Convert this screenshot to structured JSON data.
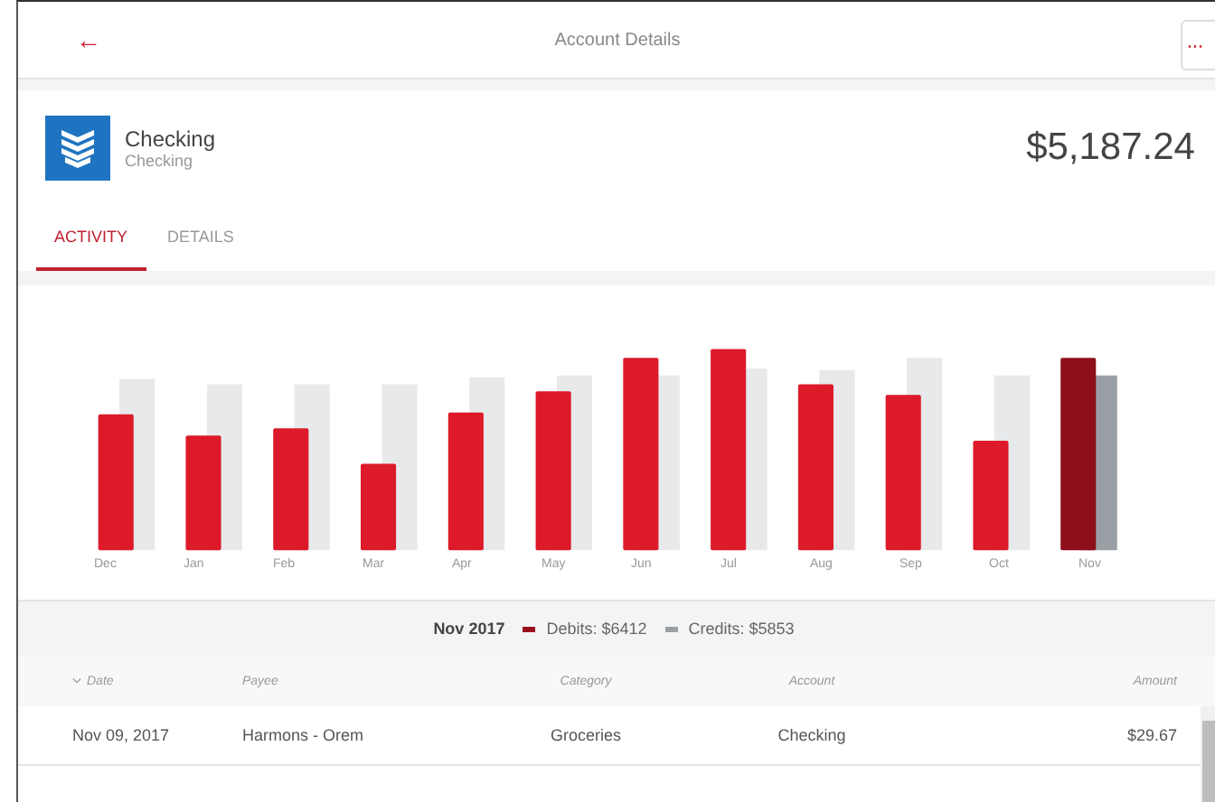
{
  "header": {
    "back": "←",
    "title": "Account Details",
    "more": "···"
  },
  "account": {
    "name": "Checking",
    "type": "Checking",
    "balance": "$5,187.24"
  },
  "tabs": [
    {
      "label": "ACTIVITY",
      "selected": true
    },
    {
      "label": "DETAILS",
      "selected": false
    }
  ],
  "months": [
    {
      "label": "Dec",
      "selected": false
    },
    {
      "label": "Jan",
      "selected": false
    },
    {
      "label": "Feb",
      "selected": false
    },
    {
      "label": "Mar",
      "selected": false
    },
    {
      "label": "Apr",
      "selected": false
    },
    {
      "label": "May",
      "selected": false
    },
    {
      "label": "Jun",
      "selected": false
    },
    {
      "label": "Jul",
      "selected": false
    },
    {
      "label": "Aug",
      "selected": false
    },
    {
      "label": "Sep",
      "selected": false
    },
    {
      "label": "Oct",
      "selected": false
    },
    {
      "label": "Nov",
      "selected": true
    }
  ],
  "summary": {
    "period": "Nov 2017",
    "debits": "Debits: $6412",
    "credits": "Credits: $5853"
  },
  "table": {
    "columns": [
      "Date",
      "Payee",
      "Category",
      "Account",
      "Amount"
    ],
    "rows": [
      {
        "cells": [
          "Nov 09, 2017",
          "Harmons - Orem",
          "Groceries",
          "Checking",
          "$29.67"
        ]
      }
    ]
  }
}
